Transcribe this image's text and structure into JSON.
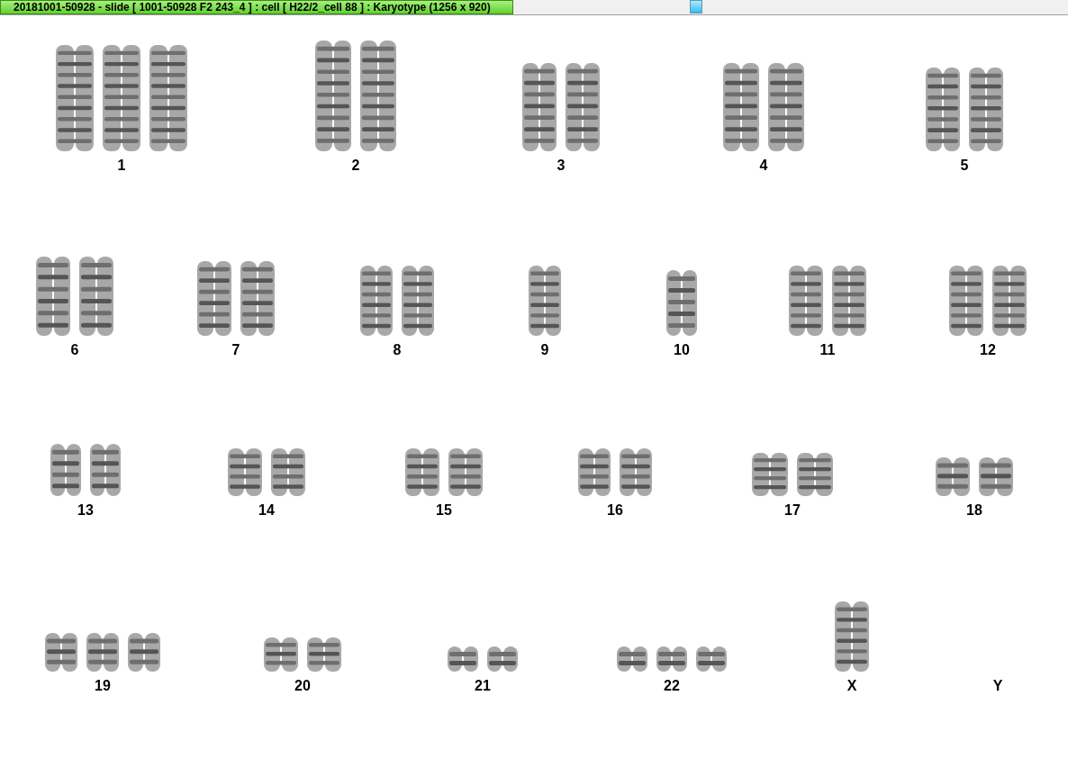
{
  "window": {
    "title": "20181001-50928 - slide [ 1001-50928 F2 243_4 ] : cell [ H22/2_cell 88 ] : Karyotype  (1256 x 920)"
  },
  "karyotype": {
    "groups": [
      {
        "label": "1"
      },
      {
        "label": "2"
      },
      {
        "label": "3"
      },
      {
        "label": "4"
      },
      {
        "label": "5"
      },
      {
        "label": "6"
      },
      {
        "label": "7"
      },
      {
        "label": "8"
      },
      {
        "label": "9"
      },
      {
        "label": "10"
      },
      {
        "label": "11"
      },
      {
        "label": "12"
      },
      {
        "label": "13"
      },
      {
        "label": "14"
      },
      {
        "label": "15"
      },
      {
        "label": "16"
      },
      {
        "label": "17"
      },
      {
        "label": "18"
      },
      {
        "label": "19"
      },
      {
        "label": "20"
      },
      {
        "label": "21"
      },
      {
        "label": "22"
      },
      {
        "label": "X"
      },
      {
        "label": "Y"
      }
    ]
  }
}
